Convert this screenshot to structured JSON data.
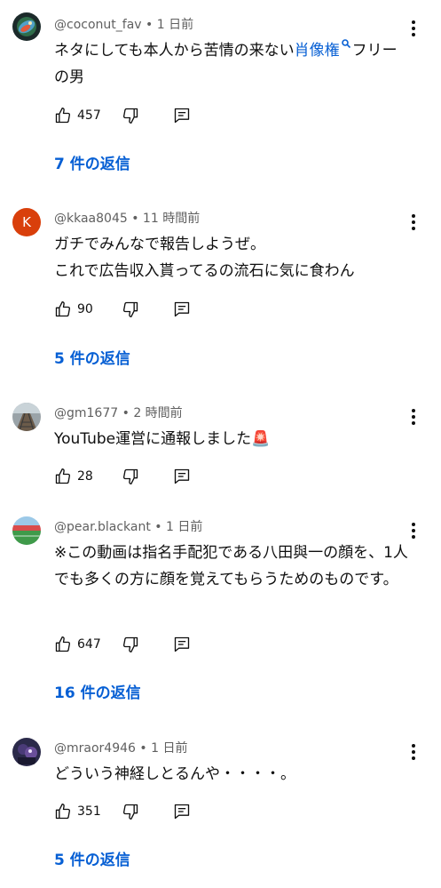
{
  "comments": [
    {
      "handle": "@coconut_fav",
      "time": " • 1 日前",
      "text_before": "ネタにしても本人から苦情の来ない",
      "text_link": "肖像権",
      "text_after": "フリーの男",
      "likes": "457",
      "replies": "7 件の返信"
    },
    {
      "handle": "@kkaa8045",
      "time": " • 11 時間前",
      "line1": "ガチでみんなで報告しようぜ。",
      "line2": "これで広告収入貰ってるの流石に気に食わん",
      "avatar_letter": "K",
      "likes": "90",
      "replies": "5 件の返信"
    },
    {
      "handle": "@gm1677",
      "time": " • 2 時間前",
      "text": "YouTube運営に通報しました🚨",
      "likes": "28"
    },
    {
      "handle": "@pear.blackant",
      "time": " • 1 日前",
      "text": "※この動画は指名手配犯である八田與一の顔を、1人でも多くの方に顔を覚えてもらうためのものです。",
      "likes": "647",
      "replies": "16 件の返信"
    },
    {
      "handle": "@mraor4946",
      "time": " • 1 日前",
      "text": "どういう神経しとるんや・・・・。",
      "likes": "351",
      "replies": "5 件の返信"
    }
  ],
  "colors": {
    "link": "#065fd4",
    "meta": "#606060",
    "avatar_k": "#d93f0b"
  }
}
